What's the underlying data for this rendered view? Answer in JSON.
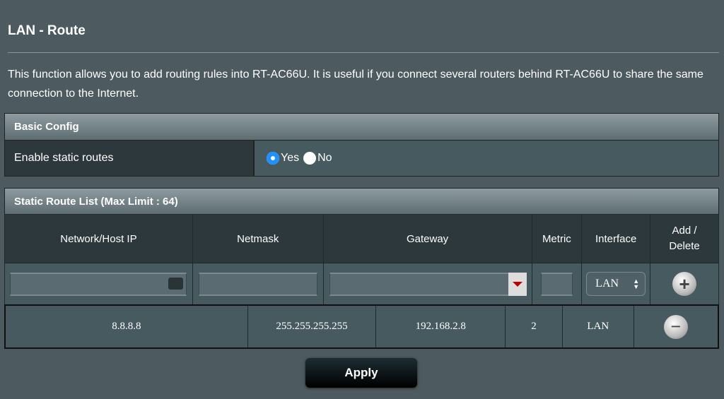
{
  "page": {
    "title": "LAN - Route",
    "description": "This function allows you to add routing rules into RT-AC66U. It is useful if you connect several routers behind RT-AC66U to share the same connection to the Internet."
  },
  "basic_config": {
    "header": "Basic Config",
    "label": "Enable static routes",
    "options": [
      "Yes",
      "No"
    ],
    "selected": "Yes"
  },
  "route_list": {
    "header": "Static Route List (Max Limit : 64)",
    "columns": [
      "Network/Host IP",
      "Netmask",
      "Gateway",
      "Metric",
      "Interface",
      "Add / Delete"
    ],
    "new_entry": {
      "network": "",
      "netmask": "",
      "gateway": "",
      "metric": "",
      "interface": "LAN"
    },
    "rows": [
      {
        "network": "8.8.8.8",
        "netmask": "255.255.255.255",
        "gateway": "192.168.2.8",
        "metric": "2",
        "interface": "LAN"
      }
    ]
  },
  "apply_label": "Apply",
  "colors": {
    "background": "#4d5a5f",
    "radio_selected": "#1e90ff",
    "dropdown_arrow": "#c00000"
  }
}
